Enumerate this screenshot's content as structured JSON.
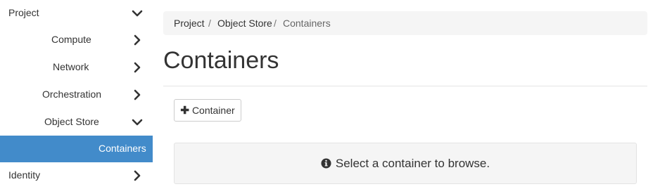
{
  "sidebar": {
    "project": {
      "label": "Project",
      "icon": "chevron-down-icon"
    },
    "compute": {
      "label": "Compute",
      "icon": "chevron-right-icon"
    },
    "network": {
      "label": "Network",
      "icon": "chevron-right-icon"
    },
    "orchestration": {
      "label": "Orchestration",
      "icon": "chevron-right-icon"
    },
    "object_store": {
      "label": "Object Store",
      "icon": "chevron-down-icon"
    },
    "containers": {
      "label": "Containers",
      "active": true
    },
    "identity": {
      "label": "Identity",
      "icon": "chevron-right-icon"
    }
  },
  "breadcrumb": {
    "items": [
      "Project",
      "Object Store",
      "Containers"
    ],
    "separator": "/"
  },
  "page": {
    "title": "Containers",
    "add_button_label": "Container",
    "add_button_icon": "plus-icon",
    "empty_message": "Select a container to browse.",
    "empty_message_icon": "info-circle-icon"
  },
  "colors": {
    "active_nav_bg": "#428bca",
    "breadcrumb_bg": "#f5f5f5",
    "info_box_bg": "#f5f5f5"
  }
}
